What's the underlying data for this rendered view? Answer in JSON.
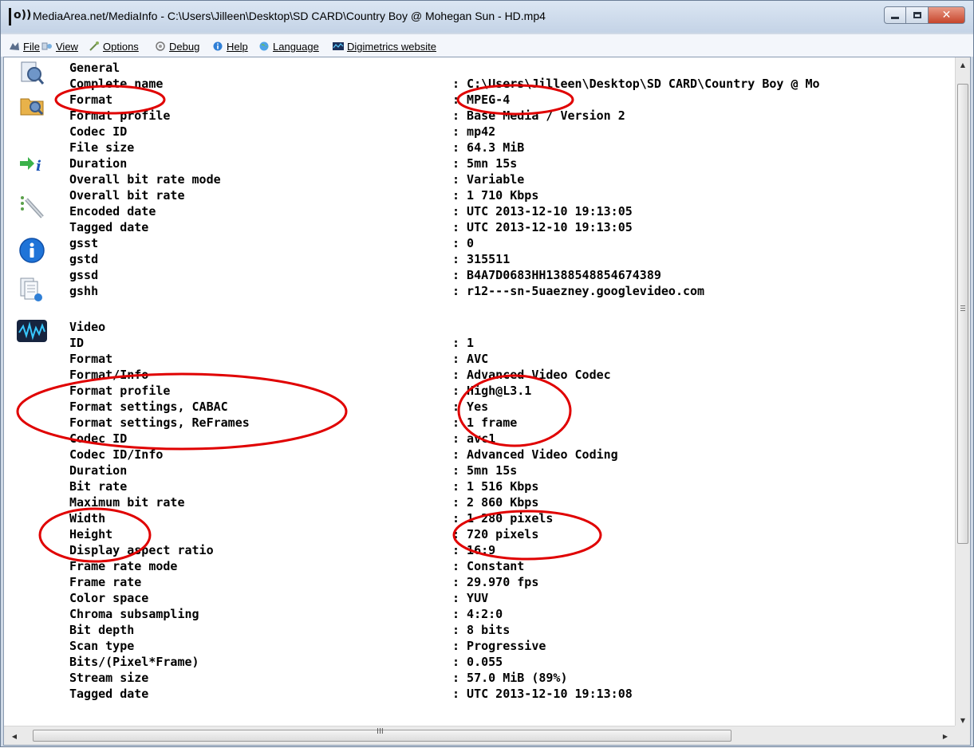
{
  "window": {
    "title": "MediaArea.net/MediaInfo - C:\\Users\\Jilleen\\Desktop\\SD CARD\\Country Boy @  Mohegan Sun - HD.mp4",
    "app_icon_glyph": "|o))",
    "buttons": {
      "minimize": "minimize-icon",
      "maximize": "maximize-icon",
      "close": "✕"
    }
  },
  "menu": {
    "items": [
      {
        "label": "File",
        "icon": "file-icon"
      },
      {
        "label": "View",
        "icon": "view-icon"
      },
      {
        "label": "Options",
        "icon": "options-icon"
      },
      {
        "label": "Debug",
        "icon": "debug-icon"
      },
      {
        "label": "Help",
        "icon": "help-icon"
      },
      {
        "label": "Language",
        "icon": "language-icon"
      },
      {
        "label": "Digimetrics website",
        "icon": "digimetrics-icon"
      }
    ]
  },
  "toolbar": {
    "tools": [
      "open-file-icon",
      "open-folder-icon",
      "export-icon",
      "preferences-icon",
      "info-icon",
      "sheet-view-icon",
      "waveform-icon"
    ]
  },
  "general": {
    "heading": "General",
    "rows": [
      {
        "key": "Complete name",
        "value": ": C:\\Users\\Jilleen\\Desktop\\SD CARD\\Country Boy @  Mo"
      },
      {
        "key": "Format",
        "value": ": MPEG-4"
      },
      {
        "key": "Format profile",
        "value": ": Base Media / Version 2"
      },
      {
        "key": "Codec ID",
        "value": ": mp42"
      },
      {
        "key": "File size",
        "value": ": 64.3 MiB"
      },
      {
        "key": "Duration",
        "value": ": 5mn 15s"
      },
      {
        "key": "Overall bit rate mode",
        "value": ": Variable"
      },
      {
        "key": "Overall bit rate",
        "value": ": 1 710 Kbps"
      },
      {
        "key": "Encoded date",
        "value": ": UTC 2013-12-10 19:13:05"
      },
      {
        "key": "Tagged date",
        "value": ": UTC 2013-12-10 19:13:05"
      },
      {
        "key": "gsst",
        "value": ": 0"
      },
      {
        "key": "gstd",
        "value": ": 315511"
      },
      {
        "key": "gssd",
        "value": ": B4A7D0683HH1388548854674389"
      },
      {
        "key": "gshh",
        "value": ": r12---sn-5uaezney.googlevideo.com"
      }
    ]
  },
  "video": {
    "heading": "Video",
    "rows": [
      {
        "key": "ID",
        "value": ": 1"
      },
      {
        "key": "Format",
        "value": ": AVC"
      },
      {
        "key": "Format/Info",
        "value": ": Advanced Video Codec"
      },
      {
        "key": "Format profile",
        "value": ": High@L3.1"
      },
      {
        "key": "Format settings, CABAC",
        "value": ": Yes"
      },
      {
        "key": "Format settings, ReFrames",
        "value": ": 1 frame"
      },
      {
        "key": "Codec ID",
        "value": ": avc1"
      },
      {
        "key": "Codec ID/Info",
        "value": ": Advanced Video Coding"
      },
      {
        "key": "Duration",
        "value": ": 5mn 15s"
      },
      {
        "key": "Bit rate",
        "value": ": 1 516 Kbps"
      },
      {
        "key": "Maximum bit rate",
        "value": ": 2 860 Kbps"
      },
      {
        "key": "Width",
        "value": ": 1 280 pixels"
      },
      {
        "key": "Height",
        "value": ": 720 pixels"
      },
      {
        "key": "Display aspect ratio",
        "value": ": 16:9"
      },
      {
        "key": "Frame rate mode",
        "value": ": Constant"
      },
      {
        "key": "Frame rate",
        "value": ": 29.970 fps"
      },
      {
        "key": "Color space",
        "value": ": YUV"
      },
      {
        "key": "Chroma subsampling",
        "value": ": 4:2:0"
      },
      {
        "key": "Bit depth",
        "value": ": 8 bits"
      },
      {
        "key": "Scan type",
        "value": ": Progressive"
      },
      {
        "key": "Bits/(Pixel*Frame)",
        "value": ": 0.055"
      },
      {
        "key": "Stream size",
        "value": ": 57.0 MiB (89%)"
      },
      {
        "key": "Tagged date",
        "value": ": UTC 2013-12-10 19:13:08"
      }
    ]
  },
  "scrollbars": {
    "horizontal_grip": "III"
  },
  "colors": {
    "annotation_red": "#e00000",
    "titlebar_close": "#c6452c"
  }
}
